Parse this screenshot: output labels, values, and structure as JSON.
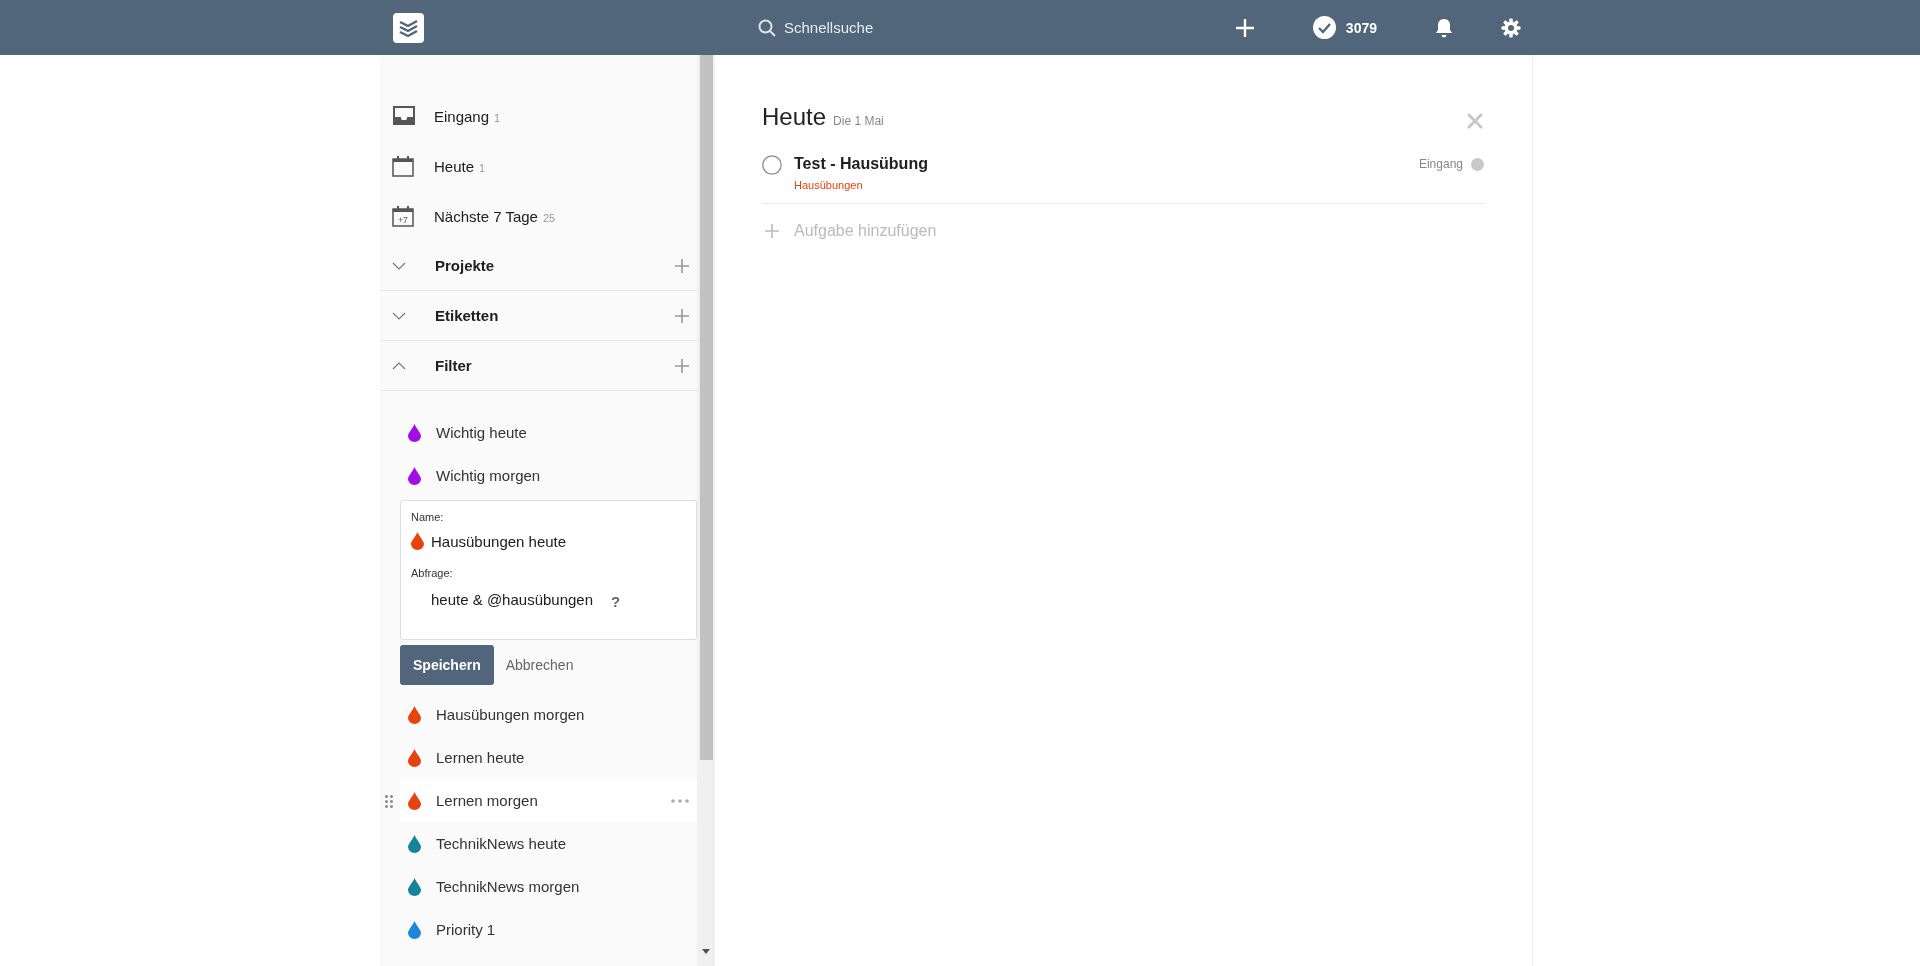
{
  "topbar": {
    "search_placeholder": "Schnellsuche",
    "karma": "3079"
  },
  "nav": [
    {
      "kind": "inbox",
      "label": "Eingang",
      "count": "1"
    },
    {
      "kind": "calendar",
      "label": "Heute",
      "count": "1"
    },
    {
      "kind": "week",
      "label": "Nächste 7 Tage",
      "count": "25",
      "icon_text": "+7"
    }
  ],
  "sections": [
    {
      "title": "Projekte",
      "expanded": false
    },
    {
      "title": "Etiketten",
      "expanded": false
    },
    {
      "title": "Filter",
      "expanded": true
    }
  ],
  "filters": [
    {
      "kind": "filter",
      "name": "Wichtig heute",
      "color": "#a20de6",
      "hovered": false
    },
    {
      "kind": "filter",
      "name": "Wichtig morgen",
      "color": "#a20de6",
      "hovered": false
    },
    {
      "kind": "editor",
      "name_label": "Name:",
      "name": "Hausübungen heute",
      "color": "#e8430f",
      "query_label": "Abfrage:",
      "query": "heute & @hausübungen",
      "help": "?",
      "save": "Speichern",
      "cancel": "Abbrechen"
    },
    {
      "kind": "filter",
      "name": "Hausübungen morgen",
      "color": "#e8430f",
      "hovered": false
    },
    {
      "kind": "filter",
      "name": "Lernen heute",
      "color": "#e8430f",
      "hovered": false
    },
    {
      "kind": "filter",
      "name": "Lernen morgen",
      "color": "#e8430f",
      "hovered": true
    },
    {
      "kind": "filter",
      "name": "TechnikNews heute",
      "color": "#13849a",
      "hovered": false
    },
    {
      "kind": "filter",
      "name": "TechnikNews morgen",
      "color": "#13849a",
      "hovered": false
    },
    {
      "kind": "filter",
      "name": "Priority 1",
      "color": "#1a87d8",
      "hovered": false
    }
  ],
  "main": {
    "title": "Heute",
    "date": "Die 1 Mai",
    "tasks": [
      {
        "title": "Test - Hausübung",
        "label": "Hausübungen",
        "project": "Eingang",
        "checked": false
      }
    ],
    "add_task": "Aufgabe hinzufügen"
  }
}
